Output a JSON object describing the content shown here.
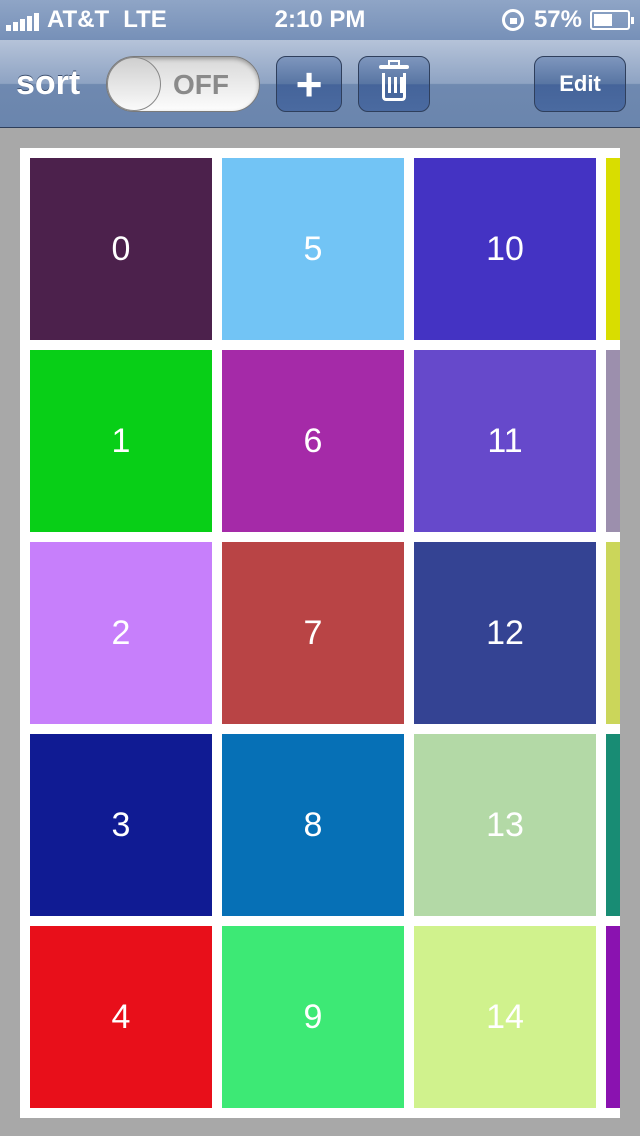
{
  "status_bar": {
    "carrier": "AT&T",
    "network": "LTE",
    "time": "2:10 PM",
    "battery": "57%",
    "battery_level": 0.57
  },
  "toolbar": {
    "sort_label": "sort",
    "toggle_state": "OFF",
    "add_label": "+",
    "edit_label": "Edit"
  },
  "grid": {
    "cells": [
      {
        "label": "0",
        "color": "#4c214c"
      },
      {
        "label": "1",
        "color": "#08cf17"
      },
      {
        "label": "2",
        "color": "#c77ffb"
      },
      {
        "label": "3",
        "color": "#101b93"
      },
      {
        "label": "4",
        "color": "#e80f1a"
      },
      {
        "label": "5",
        "color": "#72c4f5"
      },
      {
        "label": "6",
        "color": "#a52aa8"
      },
      {
        "label": "7",
        "color": "#b94445"
      },
      {
        "label": "8",
        "color": "#0670b6"
      },
      {
        "label": "9",
        "color": "#3de975"
      },
      {
        "label": "10",
        "color": "#4433c3"
      },
      {
        "label": "11",
        "color": "#6649cb"
      },
      {
        "label": "12",
        "color": "#344393"
      },
      {
        "label": "13",
        "color": "#b3d9a6"
      },
      {
        "label": "14",
        "color": "#d0f28d"
      },
      {
        "label": "",
        "color": "#d9dd00"
      },
      {
        "label": "",
        "color": "#9c8fad"
      },
      {
        "label": "",
        "color": "#cbd65a"
      },
      {
        "label": "",
        "color": "#188c74"
      },
      {
        "label": "",
        "color": "#8a12b0"
      }
    ]
  }
}
